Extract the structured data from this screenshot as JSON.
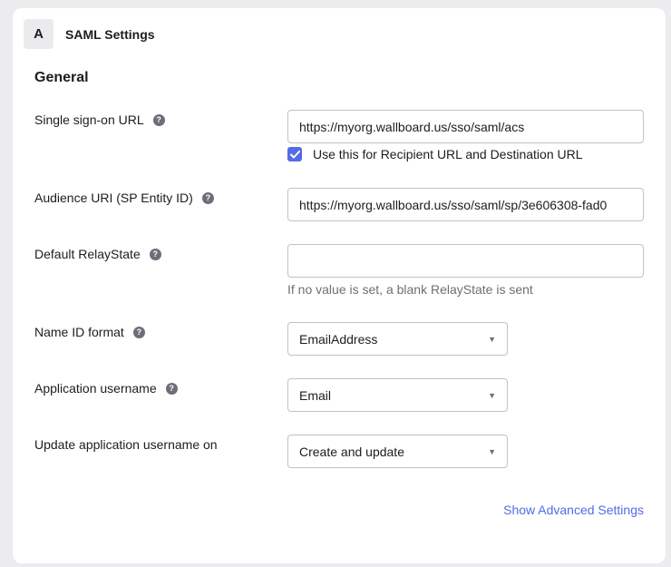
{
  "card": {
    "step": "A",
    "title": "SAML Settings"
  },
  "section": {
    "title": "General"
  },
  "fields": {
    "sso_url": {
      "label": "Single sign-on URL",
      "value": "https://myorg.wallboard.us/sso/saml/acs",
      "checkbox_label": "Use this for Recipient URL and Destination URL",
      "checkbox_checked": true
    },
    "audience_uri": {
      "label": "Audience URI (SP Entity ID)",
      "value": "https://myorg.wallboard.us/sso/saml/sp/3e606308-fad0"
    },
    "relay_state": {
      "label": "Default RelayState",
      "value": "",
      "hint": "If no value is set, a blank RelayState is sent"
    },
    "name_id_format": {
      "label": "Name ID format",
      "value": "EmailAddress"
    },
    "app_username": {
      "label": "Application username",
      "value": "Email"
    },
    "update_username_on": {
      "label": "Update application username on",
      "value": "Create and update"
    }
  },
  "links": {
    "advanced": "Show Advanced Settings"
  },
  "colors": {
    "accent": "#546be7",
    "page_background": "#ececef",
    "card_background": "#ffffff",
    "help_icon": "#6e6e78"
  },
  "icons": {
    "help": "question-mark-icon",
    "checkbox": "checkmark-icon",
    "select": "caret-down-icon"
  }
}
